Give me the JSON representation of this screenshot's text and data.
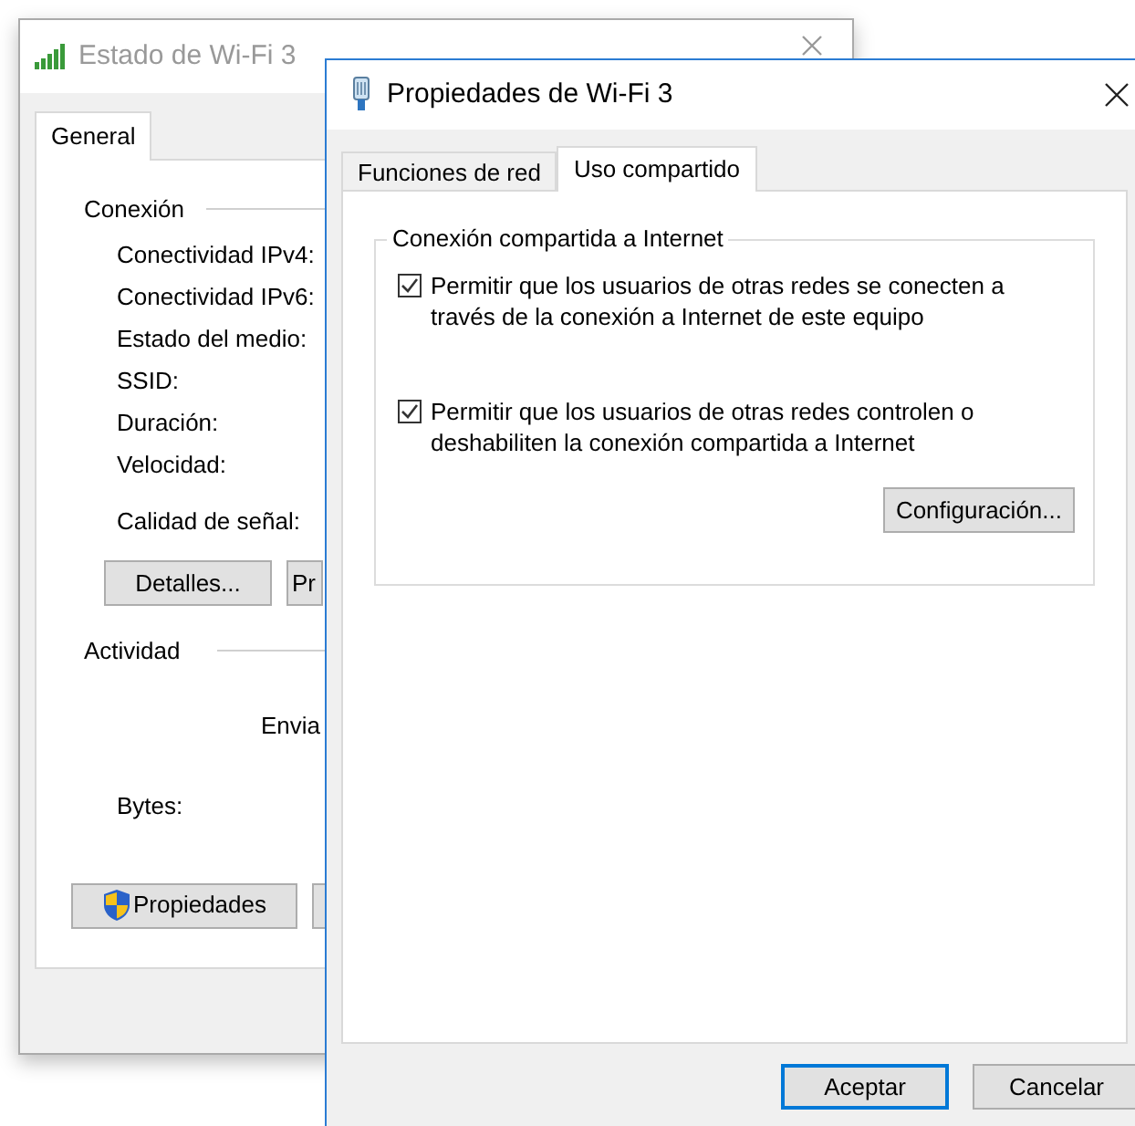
{
  "status_window": {
    "title": "Estado de Wi-Fi 3",
    "tabs": [
      {
        "label": "General",
        "selected": true
      }
    ],
    "connection": {
      "heading": "Conexión",
      "labels": [
        "Conectividad IPv4:",
        "Conectividad IPv6:",
        "Estado del medio:",
        "SSID:",
        "Duración:",
        "Velocidad:"
      ],
      "signal_label": "Calidad de señal:",
      "buttons": [
        "Detalles...",
        "Pr"
      ]
    },
    "activity": {
      "heading": "Actividad",
      "sent_label": "Envia",
      "bytes_label": "Bytes:"
    },
    "buttons": [
      "Propiedades"
    ]
  },
  "properties_window": {
    "title": "Propiedades de Wi-Fi 3",
    "tabs": [
      {
        "label": "Funciones de red",
        "selected": false
      },
      {
        "label": "Uso compartido",
        "selected": true
      }
    ],
    "group": {
      "legend": "Conexión compartida a Internet",
      "options": [
        {
          "label": "Permitir que los usuarios de otras redes se conecten a través de la conexión a Internet de este equipo",
          "checked": true
        },
        {
          "label": "Permitir que los usuarios de otras redes controlen o deshabiliten la conexión compartida a Internet",
          "checked": true
        }
      ],
      "button": "Configuración..."
    },
    "buttons": [
      {
        "label": "Aceptar",
        "default": true
      },
      {
        "label": "Cancelar",
        "default": false
      }
    ]
  }
}
